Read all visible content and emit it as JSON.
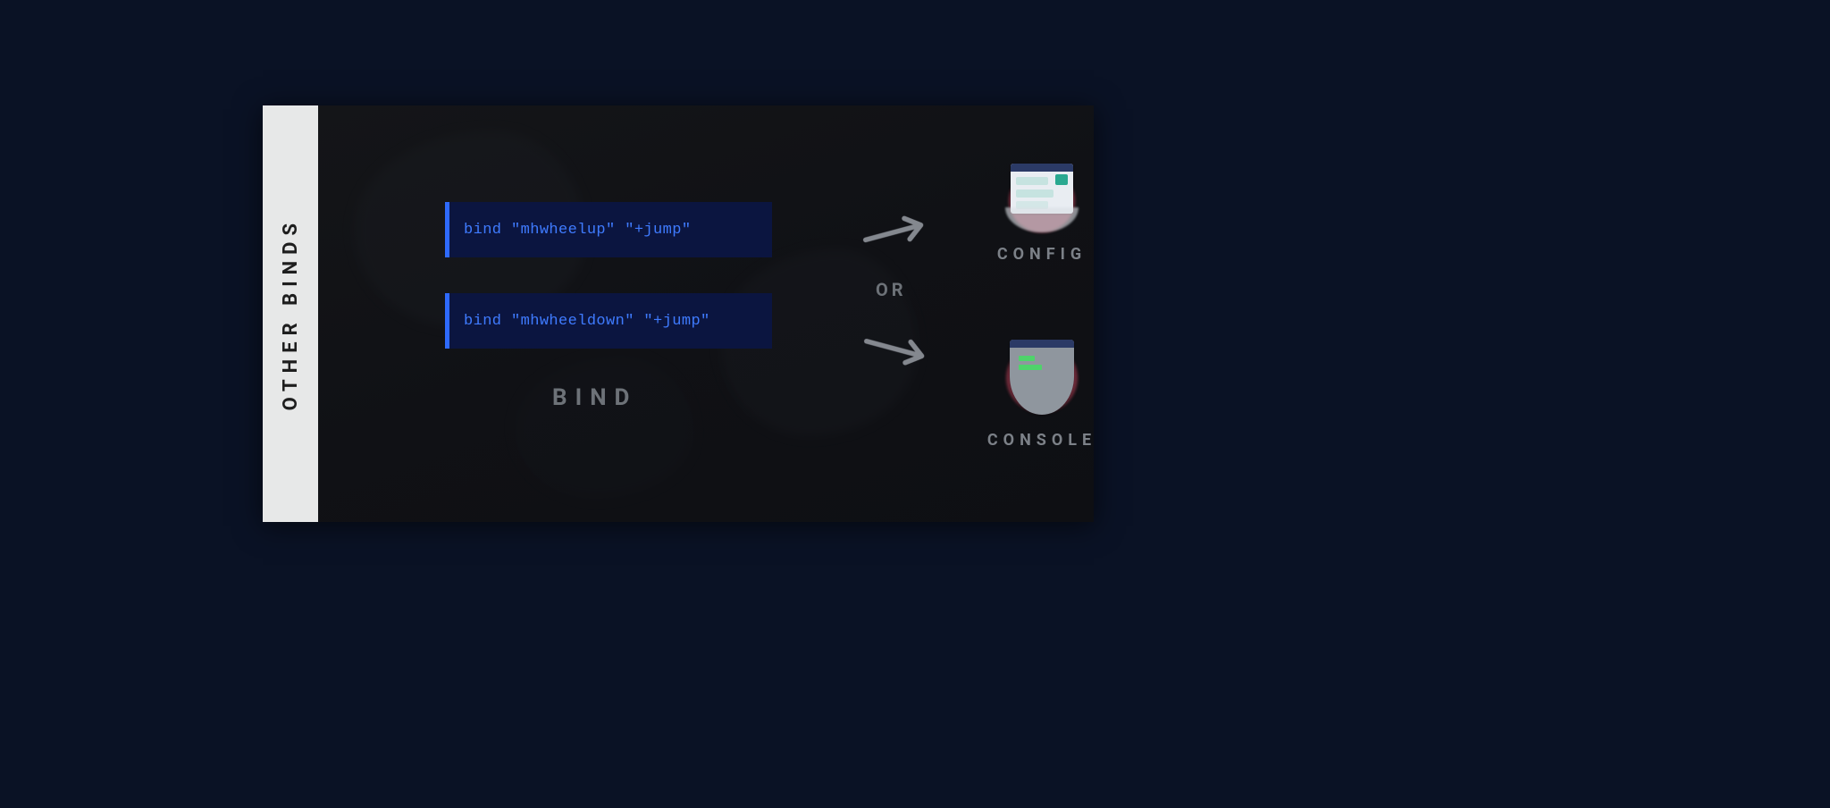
{
  "sidebar": {
    "title": "OTHER BINDS"
  },
  "bind": {
    "code1": "bind \"mhwheelup\" \"+jump\"",
    "code2": "bind \"mhwheeldown\" \"+jump\"",
    "label": "BIND"
  },
  "connector": {
    "or": "OR"
  },
  "dest": {
    "config": "CONFIG",
    "console": "CONSOLE"
  }
}
